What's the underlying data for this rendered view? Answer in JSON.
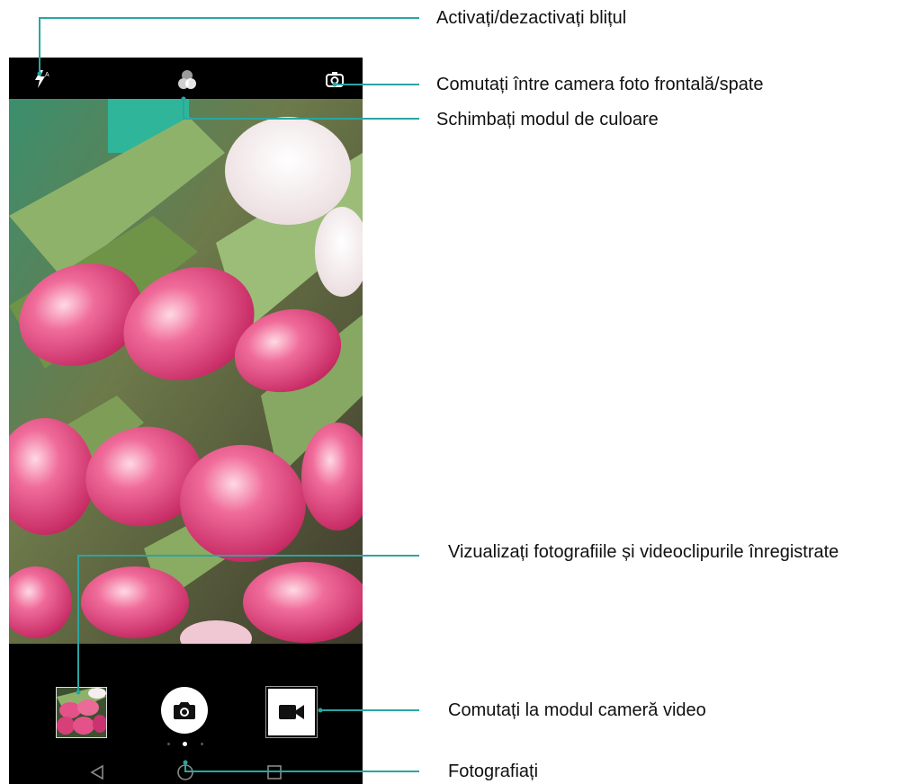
{
  "callouts": {
    "flash": "Activați/dezactivați blițul",
    "switch_camera": "Comutați între camera foto frontală/spate",
    "color_mode": "Schimbați modul de culoare",
    "gallery": "Vizualizați fotografiile și videoclipurile înregistrate",
    "video_mode": "Comutați la modul cameră video",
    "shutter": "Fotografiați"
  },
  "topbar": {
    "flash_icon": "flash-auto-icon",
    "flash_badge": "A",
    "filter_icon": "color-filter-icon",
    "switch_icon": "switch-camera-icon"
  },
  "bottom": {
    "gallery_thumbnail": "gallery-thumbnail",
    "shutter_icon": "camera-icon",
    "video_icon": "video-camera-icon",
    "mode_dots": {
      "count": 3,
      "active_index": 1
    }
  },
  "navbar": {
    "back_icon": "back-triangle-icon",
    "home_icon": "home-circle-icon",
    "recents_icon": "recents-square-icon"
  },
  "colors": {
    "callout_line": "#2aa6a1",
    "background": "#000000",
    "tulip_pink": "#e84a86",
    "leaf_green": "#7c9a56"
  }
}
